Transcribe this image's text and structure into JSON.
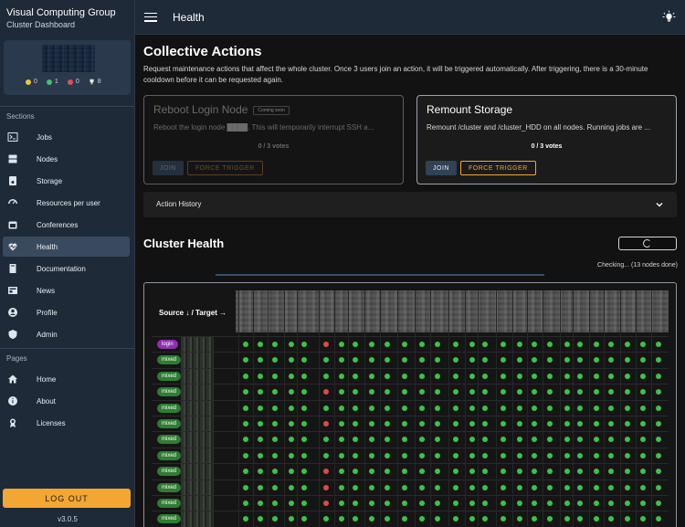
{
  "sidebar": {
    "org": "Visual Computing Group",
    "subtitle": "Cluster Dashboard",
    "status": [
      {
        "color": "#f3c33b",
        "value": "0"
      },
      {
        "color": "#43c06a",
        "value": "1"
      },
      {
        "color": "#e0505a",
        "value": "0"
      },
      {
        "icon": "trophy-icon",
        "value": "8"
      }
    ],
    "sections_label": "Sections",
    "sections": [
      {
        "label": "Jobs",
        "icon": "terminal-icon"
      },
      {
        "label": "Nodes",
        "icon": "nodes-icon"
      },
      {
        "label": "Storage",
        "icon": "storage-icon"
      },
      {
        "label": "Resources per user",
        "icon": "gauge-icon"
      },
      {
        "label": "Conferences",
        "icon": "calendar-icon"
      },
      {
        "label": "Health",
        "icon": "heartbeat-icon"
      },
      {
        "label": "Documentation",
        "icon": "book-icon"
      },
      {
        "label": "News",
        "icon": "news-icon"
      },
      {
        "label": "Profile",
        "icon": "account-icon"
      },
      {
        "label": "Admin",
        "icon": "shield-icon"
      }
    ],
    "pages_label": "Pages",
    "pages": [
      {
        "label": "Home",
        "icon": "home-icon"
      },
      {
        "label": "About",
        "icon": "info-icon"
      },
      {
        "label": "Licenses",
        "icon": "license-icon"
      }
    ],
    "logout": "LOG OUT",
    "version": "v3.0.5"
  },
  "topbar": {
    "title": "Health"
  },
  "collective": {
    "title": "Collective Actions",
    "description": "Request maintenance actions that affect the whole cluster. Once 3 users join an action, it will be triggered automatically. After triggering, there is a 30-minute cooldown before it can be requested again.",
    "actions": [
      {
        "title": "Reboot Login Node",
        "badge": "Coming soon",
        "description": "Reboot the login node ████. This will temporarily interrupt SSH a...",
        "votes": "0 / 3 votes",
        "join": "JOIN",
        "force": "FORCE TRIGGER",
        "enabled": false
      },
      {
        "title": "Remount Storage",
        "description": "Remount /cluster and /cluster_HDD on all nodes. Running jobs are ...",
        "votes": "0 / 3 votes",
        "join": "JOIN",
        "force": "FORCE TRIGGER",
        "enabled": true
      }
    ],
    "history_label": "Action History"
  },
  "health": {
    "title": "Cluster Health",
    "checking": "Checking... (13 nodes done)",
    "source_target_header": "Source ↓ / Target →",
    "rows": [
      {
        "tag": "login"
      },
      {
        "tag": "mixed"
      },
      {
        "tag": "mixed"
      },
      {
        "tag": "mixed"
      },
      {
        "tag": "mixed"
      },
      {
        "tag": "mixed"
      },
      {
        "tag": "mixed"
      },
      {
        "tag": "mixed"
      },
      {
        "tag": "mixed"
      },
      {
        "tag": "mixed"
      },
      {
        "tag": "mixed"
      },
      {
        "tag": "mixed"
      }
    ],
    "colors": {
      "ok": "#3ec14a",
      "fail": "#e0474b"
    }
  }
}
